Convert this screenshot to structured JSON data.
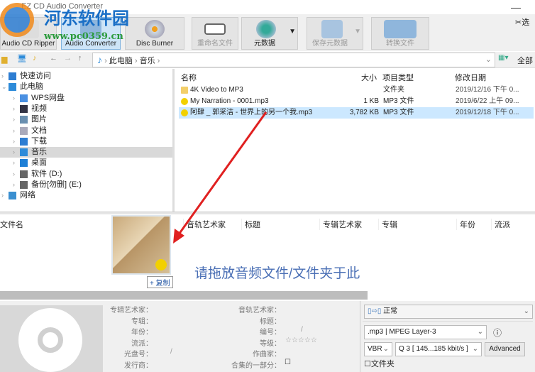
{
  "app_title": "EZ CD Audio Converter",
  "watermark": {
    "name": "河东软件园",
    "url": "www.pc0359.cn"
  },
  "toolbar": {
    "cd_ripper": "Audio CD Ripper",
    "audio_converter": "Audio Converter",
    "disc_burner": "Disc Burner",
    "rename": "重命名文件",
    "metadata": "元数据",
    "save_metadata": "保存元数据",
    "convert": "转换文件",
    "right_label": "选"
  },
  "address": {
    "path": [
      "此电脑",
      "音乐"
    ],
    "right_label": "全部"
  },
  "tree": [
    {
      "label": "快速访问",
      "icon": "star-icon",
      "color": "#2d7dd2"
    },
    {
      "label": "此电脑",
      "icon": "computer-icon",
      "color": "#2d8bd9"
    },
    {
      "label": "WPS网盘",
      "icon": "cloud-icon",
      "color": "#4a90e2"
    },
    {
      "label": "视频",
      "icon": "video-icon",
      "color": "#334"
    },
    {
      "label": "图片",
      "icon": "picture-icon",
      "color": "#6a8fb0"
    },
    {
      "label": "文档",
      "icon": "document-icon",
      "color": "#aab"
    },
    {
      "label": "下载",
      "icon": "download-icon",
      "color": "#2d7dd2"
    },
    {
      "label": "音乐",
      "icon": "music-icon",
      "color": "#2d8bd9"
    },
    {
      "label": "桌面",
      "icon": "desktop-icon",
      "color": "#1e7fd6"
    },
    {
      "label": "软件 (D:)",
      "icon": "drive-icon",
      "color": "#666"
    },
    {
      "label": "备份[勿删] (E:)",
      "icon": "drive-icon",
      "color": "#666"
    },
    {
      "label": "网络",
      "icon": "network-icon",
      "color": "#3a8fd0"
    }
  ],
  "list": {
    "headers": [
      "名称",
      "大小",
      "项目类型",
      "修改日期"
    ],
    "rows": [
      {
        "name": "4K Video to MP3",
        "size": "",
        "type": "文件夹",
        "date": "2019/12/16 下午 0...",
        "icon": "folder-icon"
      },
      {
        "name": "My Narration - 0001.mp3",
        "size": "1 KB",
        "type": "MP3 文件",
        "date": "2019/6/22 上午 09...",
        "icon": "mp3-icon"
      },
      {
        "name": "阿肆 _ 郭采洁 - 世界上的另一个我.mp3",
        "size": "3,782 KB",
        "type": "MP3 文件",
        "date": "2019/12/18 下午 0...",
        "icon": "mp3-icon"
      }
    ]
  },
  "drop": {
    "headers": [
      "文件名",
      "音轨艺术家",
      "标题",
      "专辑艺术家",
      "专辑",
      "年份",
      "流派"
    ],
    "hint": "请拖放音频文件/文件夹于此",
    "copy_label": "+ 复制"
  },
  "meta": {
    "left": [
      "专辑艺术家：",
      "专辑：",
      "年份：",
      "流派：",
      "光盘号：",
      "发行商："
    ],
    "disc_value": "/",
    "right": [
      "音轨艺术家：",
      "标题：",
      "编号：",
      "等级：",
      "作曲家：",
      "合集的一部分："
    ],
    "track_value": "/",
    "rating": "☆☆☆☆☆"
  },
  "output": {
    "preset": "正常",
    "format": ".mp3 | MPEG Layer-3",
    "mode": "VBR",
    "quality": "Q 3  [ 145...185 kbit/s ]",
    "advanced": "Advanced",
    "folder_label": "文件夹"
  }
}
